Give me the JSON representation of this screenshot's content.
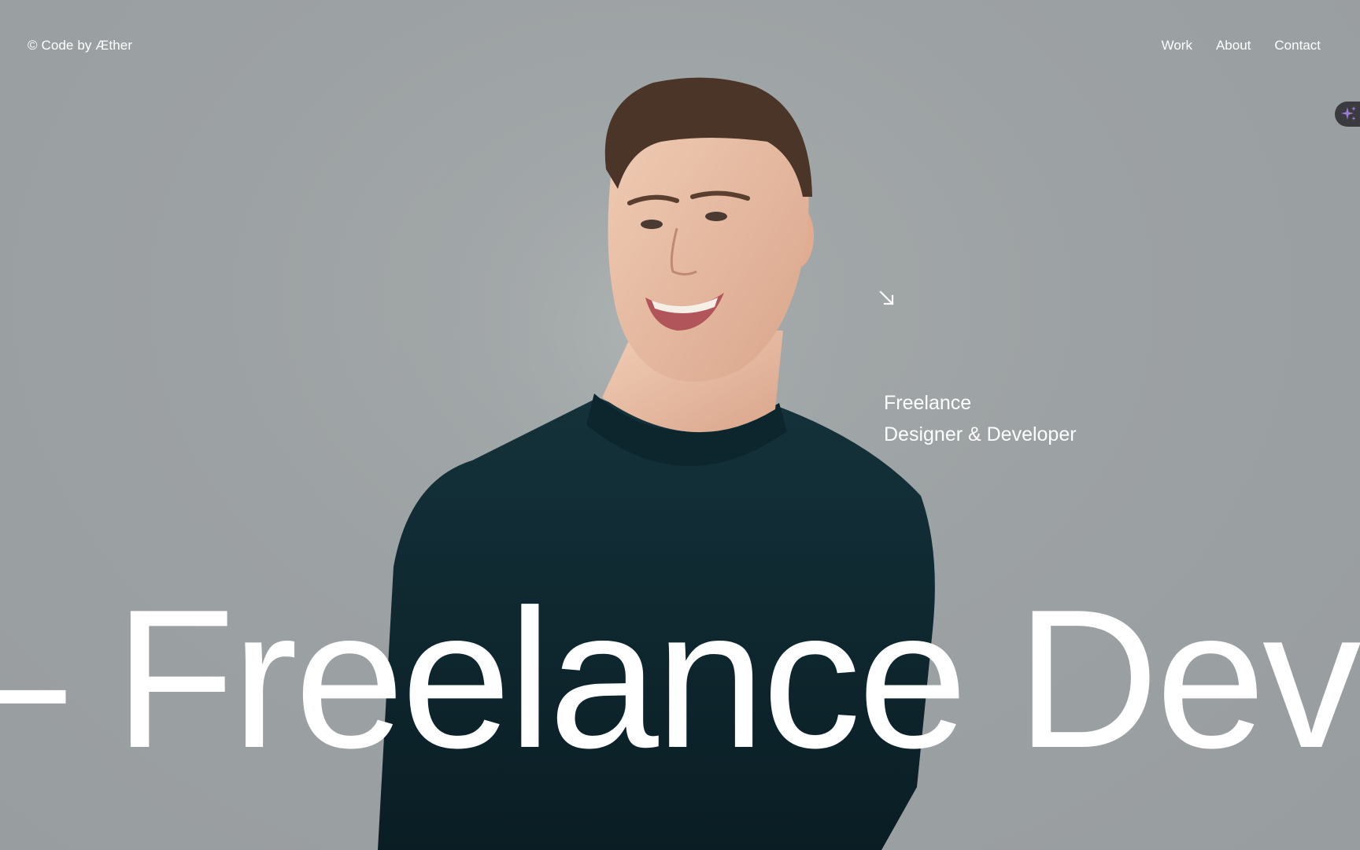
{
  "header": {
    "logo_text": "© Code by Æther",
    "nav": [
      {
        "label": "Work"
      },
      {
        "label": "About"
      },
      {
        "label": "Contact"
      }
    ]
  },
  "hero": {
    "tagline_line1": "Freelance",
    "tagline_line2": "Designer & Developer",
    "marquee_text": "– Freelance Developer",
    "arrow_icon": "arrow-down-right-icon"
  },
  "assistant": {
    "icon": "sparkle-icon",
    "accent": "#9b7bd6"
  },
  "colors": {
    "background": "#9aa0a2",
    "text": "#ffffff",
    "sweater": "#0e252d"
  }
}
